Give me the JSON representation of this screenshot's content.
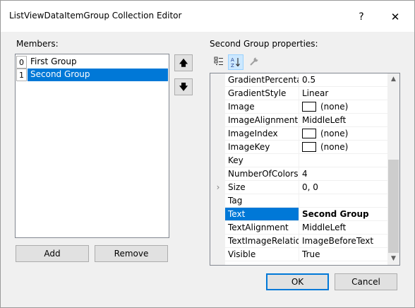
{
  "window": {
    "title": "ListViewDataItemGroup Collection Editor",
    "help_glyph": "?",
    "close_glyph": "✕"
  },
  "members": {
    "label": "Members:",
    "items": [
      {
        "index": "0",
        "name": "First Group",
        "selected": false
      },
      {
        "index": "1",
        "name": "Second Group",
        "selected": true
      }
    ],
    "move_up_glyph": "🡅",
    "move_down_glyph": "🡇",
    "add_label": "Add",
    "remove_label": "Remove"
  },
  "properties": {
    "label": "Second Group properties:",
    "toolbar": {
      "categorized_icon": "categorized-icon",
      "alphabetical_icon": "alphabetical-icon",
      "property_pages_icon": "wrench-icon"
    },
    "rows": [
      {
        "name": "GradientPercentag",
        "value": "0.5"
      },
      {
        "name": "GradientStyle",
        "value": "Linear"
      },
      {
        "name": "Image",
        "value": "(none)",
        "swatch": true
      },
      {
        "name": "ImageAlignment",
        "value": "MiddleLeft"
      },
      {
        "name": "ImageIndex",
        "value": "(none)",
        "swatch": true
      },
      {
        "name": "ImageKey",
        "value": "(none)",
        "swatch": true
      },
      {
        "name": "Key",
        "value": ""
      },
      {
        "name": "NumberOfColors",
        "value": "4"
      },
      {
        "name": "Size",
        "value": "0, 0",
        "expandable": true
      },
      {
        "name": "Tag",
        "value": ""
      },
      {
        "name": "Text",
        "value": "Second Group",
        "selected": true,
        "bold": true
      },
      {
        "name": "TextAlignment",
        "value": "MiddleLeft"
      },
      {
        "name": "TextImageRelation",
        "value": "ImageBeforeText"
      },
      {
        "name": "Visible",
        "value": "True"
      }
    ],
    "scroll_position": 0.62
  },
  "footer": {
    "ok_label": "OK",
    "cancel_label": "Cancel"
  },
  "colors": {
    "selection": "#0078d7",
    "window_bg": "#f0f0f0"
  }
}
